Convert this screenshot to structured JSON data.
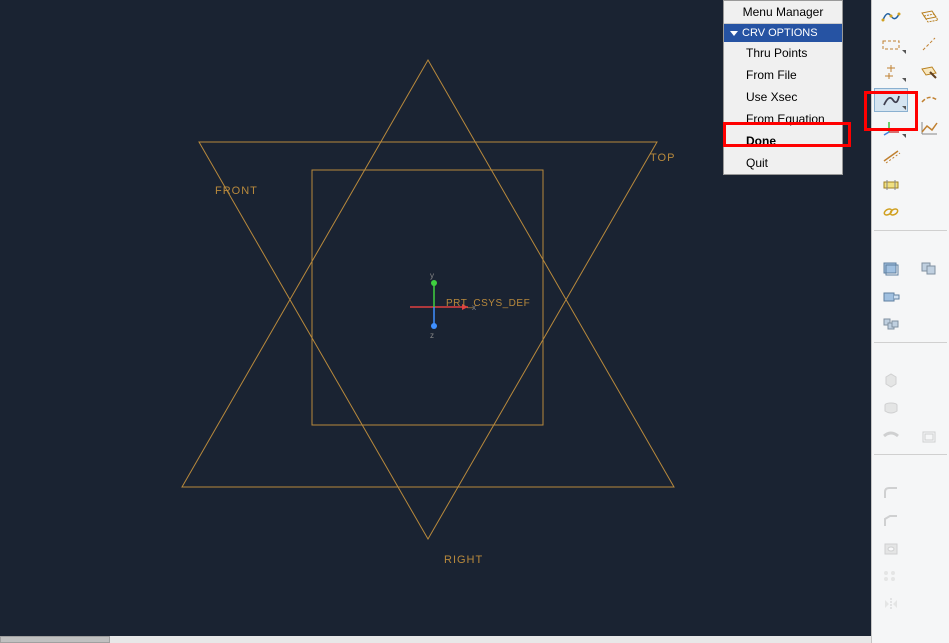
{
  "menu": {
    "title": "Menu Manager",
    "section": "CRV OPTIONS",
    "items": [
      {
        "label": "Thru Points",
        "bold": false,
        "highlighted": false
      },
      {
        "label": "From File",
        "bold": false,
        "highlighted": false
      },
      {
        "label": "Use Xsec",
        "bold": false,
        "highlighted": false
      },
      {
        "label": "From Equation",
        "bold": false,
        "highlighted": true
      },
      {
        "label": "Done",
        "bold": true,
        "highlighted": false
      },
      {
        "label": "Quit",
        "bold": false,
        "highlighted": false
      }
    ]
  },
  "labels": {
    "front": "FRONT",
    "top": "TOP",
    "right": "RIGHT",
    "csys": "PRT_CSYS_DEF"
  },
  "csys_axes": {
    "x": "x",
    "y": "y",
    "z": "z"
  },
  "tools": [
    {
      "name": "datum-curve-spline-icon"
    },
    {
      "name": "datum-plane-offset-icon"
    },
    {
      "name": "datum-plane-line-icon"
    },
    {
      "name": "datum-axis-through-icon"
    },
    {
      "name": "datum-points-icon"
    },
    {
      "name": "sketch-icon"
    },
    {
      "name": "curve-icon"
    },
    {
      "name": "trimmed-curve-icon"
    },
    {
      "name": "csys-icon"
    },
    {
      "name": "graph-icon"
    },
    {
      "name": "offset-curve-icon"
    },
    {
      "name": "dimension-icon"
    },
    {
      "name": "ruler-icon"
    },
    {
      "name": "chain-icon"
    },
    {
      "name": "face-icon"
    },
    {
      "name": "copy-geom-icon"
    },
    {
      "name": "publish-geom-icon"
    },
    {
      "name": "shrinkwrap-icon"
    },
    {
      "name": "extrude-icon-dis"
    },
    {
      "name": "sweep-icon-dis"
    },
    {
      "name": "revolve-icon-dis"
    },
    {
      "name": "shell-icon-dis"
    },
    {
      "name": "blend-icon-dis"
    },
    {
      "name": "chamfer-icon-dis"
    },
    {
      "name": "loft-icon-dis"
    },
    {
      "name": "mirror-icon-dis"
    },
    {
      "name": "round-icon-dis"
    },
    {
      "name": "pattern-icon-dis"
    },
    {
      "name": "hole-icon-dis"
    },
    {
      "name": "boolean-icon-dis"
    }
  ]
}
